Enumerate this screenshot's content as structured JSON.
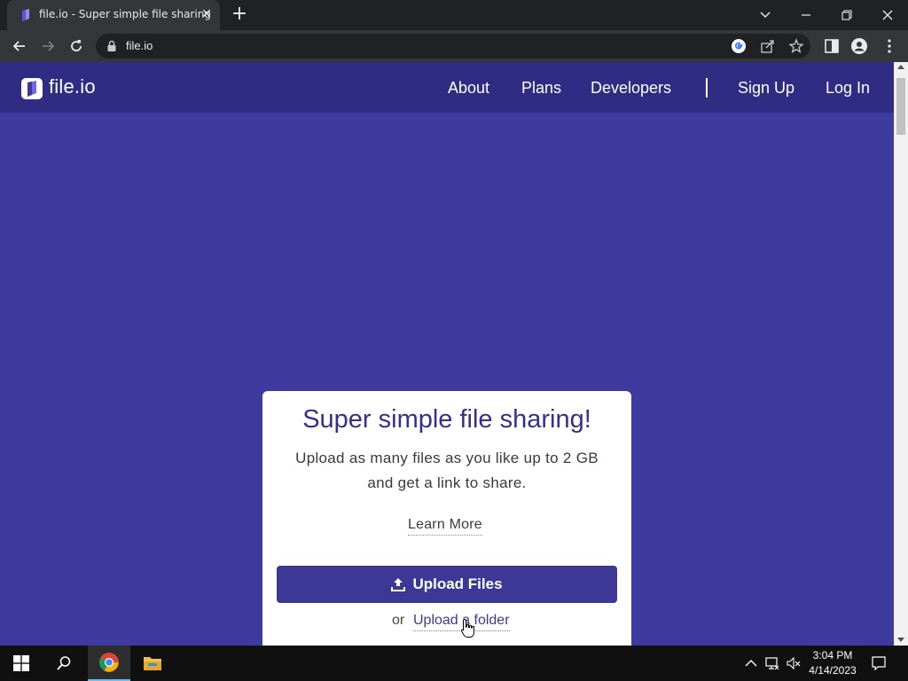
{
  "browser": {
    "tab_title": "file.io - Super simple file sharing",
    "tab_close_glyph": "✕",
    "new_tab_glyph": "+",
    "url": "file.io"
  },
  "site": {
    "logo_text": "file.io",
    "nav": {
      "about": "About",
      "plans": "Plans",
      "developers": "Developers",
      "sign_up": "Sign Up",
      "log_in": "Log In"
    },
    "hero": {
      "title": "Super simple file sharing!",
      "subtitle_line1": "Upload as many files as you like up to 2 GB",
      "subtitle_line2": "and get a link to share.",
      "learn_more": "Learn More",
      "upload_button": "Upload Files",
      "or_text": "or",
      "upload_folder": "Upload a folder"
    }
  },
  "taskbar": {
    "time": "3:04 PM",
    "date": "4/14/2023"
  },
  "colors": {
    "page_background": "#3f3a9e",
    "nav_background": "#302b83",
    "accent": "#3d3896",
    "title": "#35308f"
  }
}
